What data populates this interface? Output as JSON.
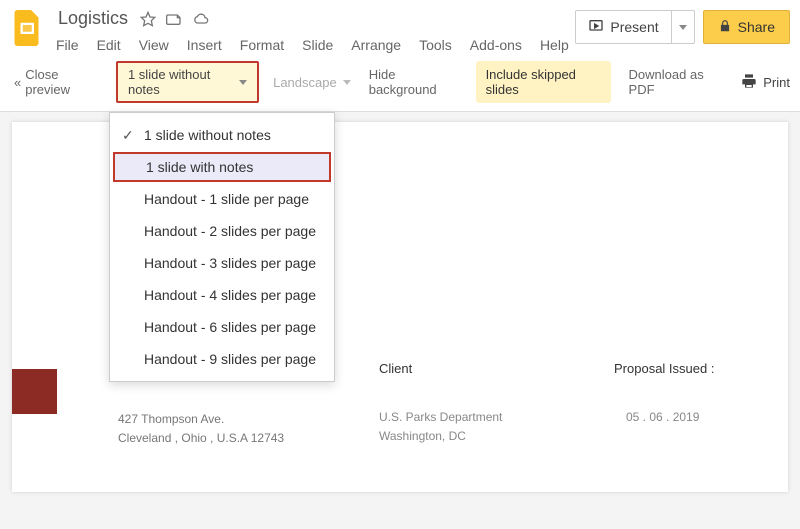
{
  "doc": {
    "title": "Logistics"
  },
  "menubar": {
    "file": "File",
    "edit": "Edit",
    "view": "View",
    "insert": "Insert",
    "format": "Format",
    "slide": "Slide",
    "arrange": "Arrange",
    "tools": "Tools",
    "addons": "Add-ons",
    "help": "Help"
  },
  "buttons": {
    "present": "Present",
    "share": "Share"
  },
  "toolbar": {
    "close": "Close preview",
    "layout_selected": "1 slide without notes",
    "orientation": "Landscape",
    "hidebg": "Hide background",
    "skipped": "Include skipped slides",
    "download": "Download as PDF",
    "print": "Print"
  },
  "dropdown": {
    "items": [
      "1 slide without notes",
      "1 slide with notes",
      "Handout - 1 slide per page",
      "Handout - 2 slides per page",
      "Handout - 3 slides per page",
      "Handout - 4 slides per page",
      "Handout - 6 slides per page",
      "Handout - 9 slides per page"
    ]
  },
  "slide": {
    "addr1": "427 Thompson Ave.",
    "addr2": "Cleveland , Ohio , U.S.A 12743",
    "client_h": "Client",
    "client1": "U.S. Parks Department",
    "client2": "Washington, DC",
    "prop_h": "Proposal Issued :",
    "prop_date": "05 . 06 . 2019"
  }
}
